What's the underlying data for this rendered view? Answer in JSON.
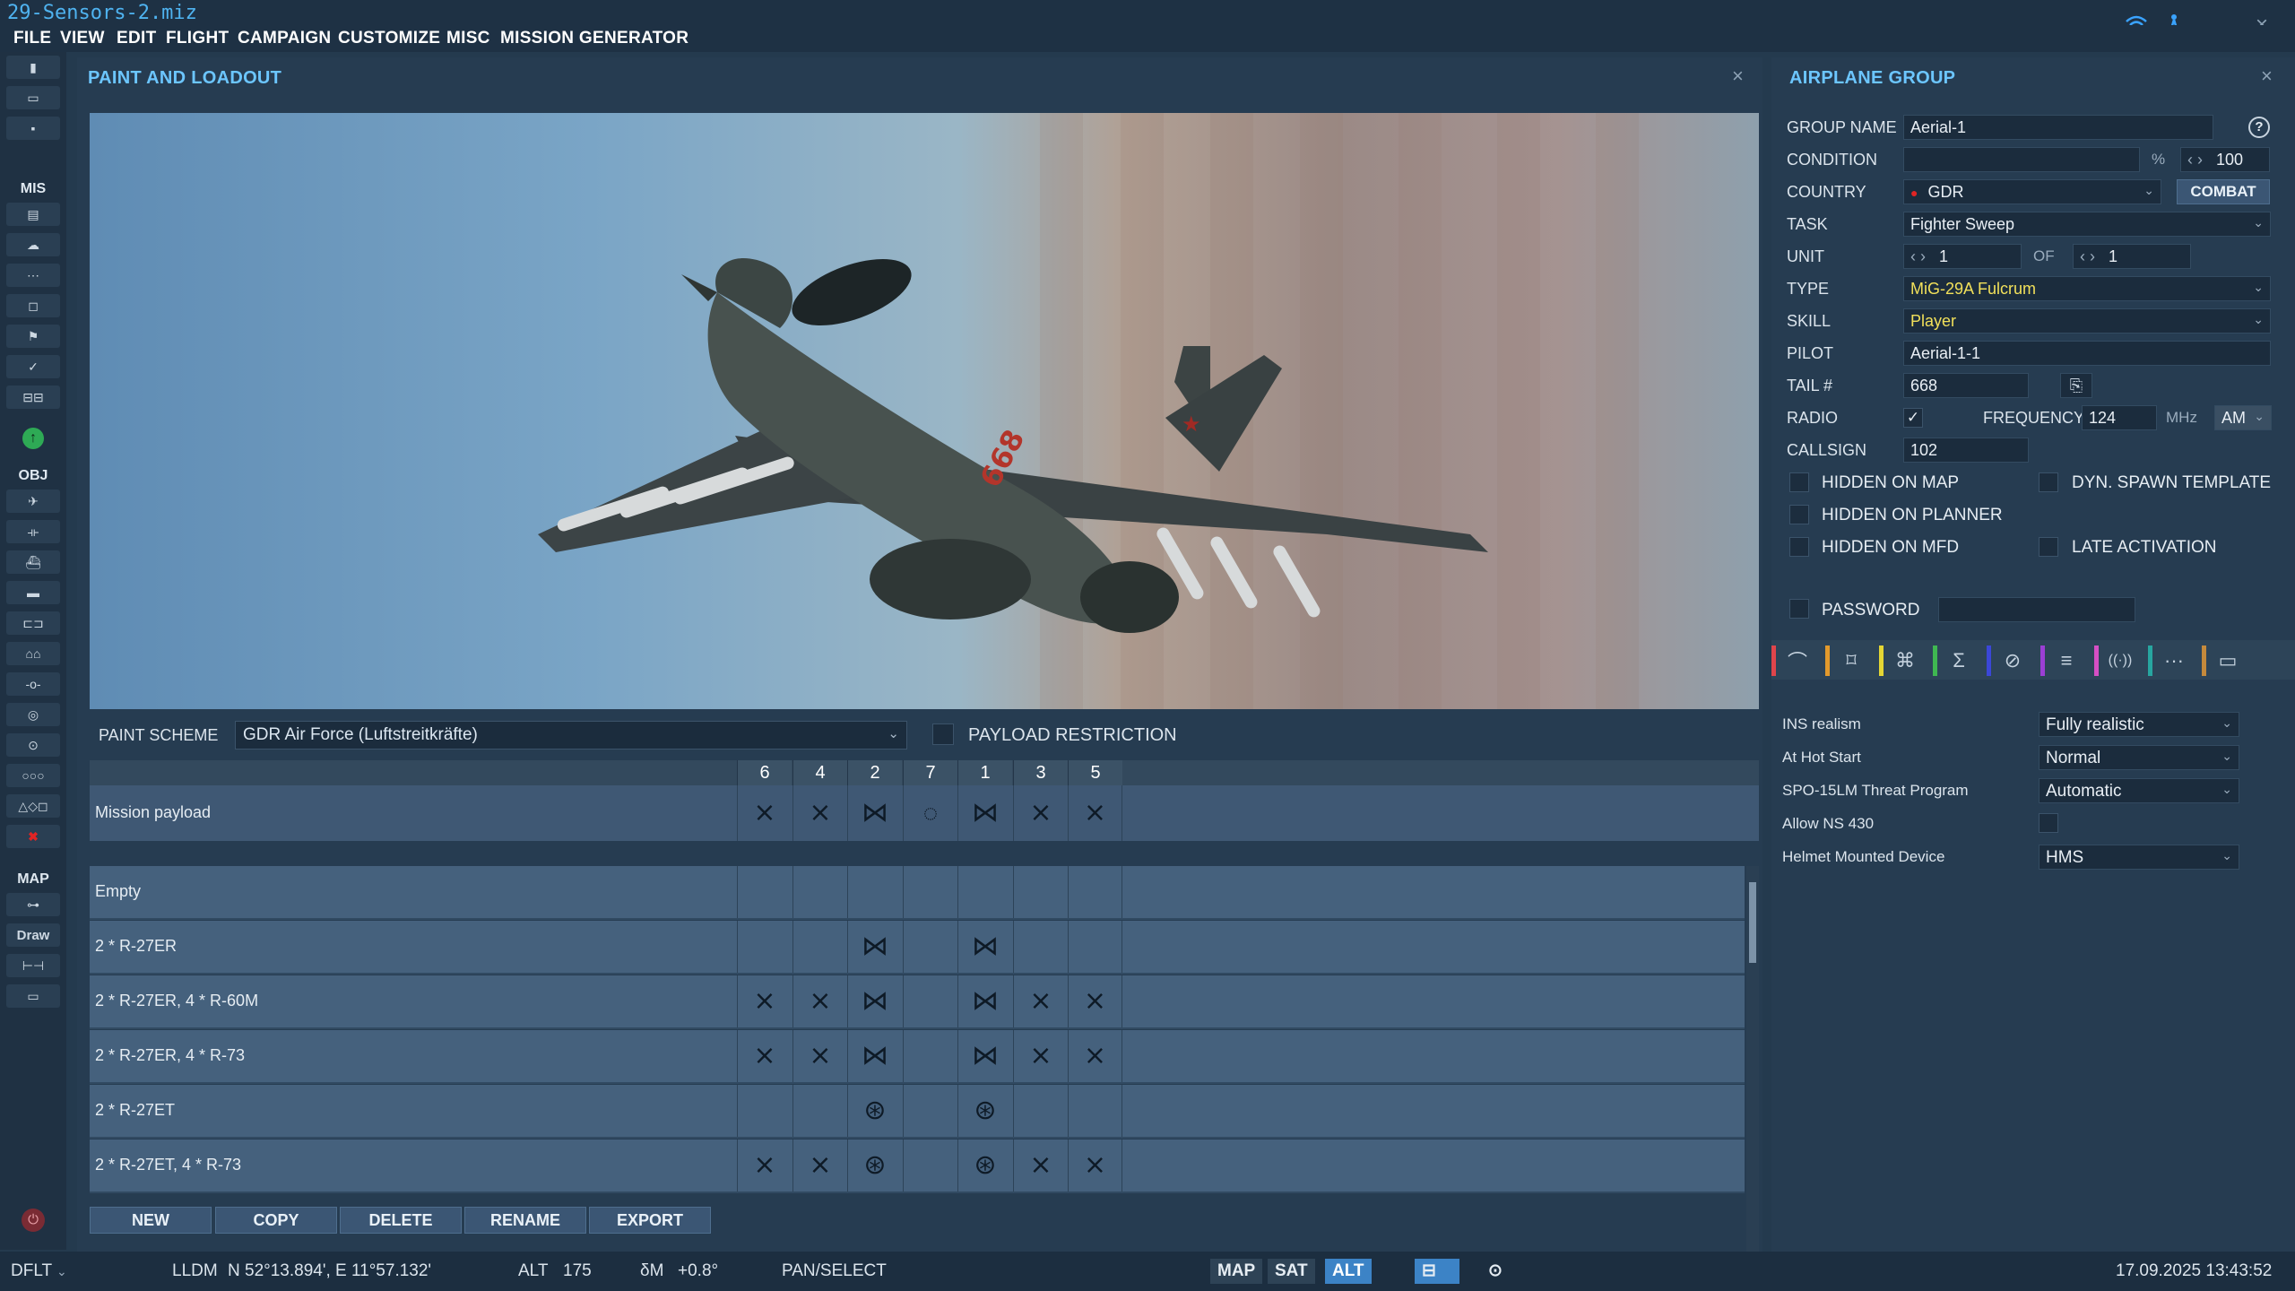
{
  "app": {
    "title": "29-Sensors-2.miz"
  },
  "menu": [
    "FILE",
    "VIEW",
    "EDIT",
    "FLIGHT",
    "CAMPAIGN",
    "CUSTOMIZE",
    "MISC",
    "MISSION GENERATOR"
  ],
  "left_toolbar": {
    "sections": [
      "MIS",
      "OBJ",
      "MAP"
    ],
    "draw_label": "Draw"
  },
  "paint_panel": {
    "title": "PAINT AND LOADOUT",
    "aircraft_tail_number_on_image": "668",
    "paint_scheme_label": "PAINT SCHEME",
    "paint_scheme_value": "GDR Air Force (Luftstreitkräfte)",
    "payload_restriction_label": "PAYLOAD RESTRICTION",
    "pylons": [
      "6",
      "4",
      "2",
      "7",
      "1",
      "3",
      "5"
    ],
    "mission_payload_label": "Mission payload",
    "loadouts": [
      {
        "name": "Empty"
      },
      {
        "name": "2 * R-27ER"
      },
      {
        "name": "2 * R-27ER, 4 * R-60M"
      },
      {
        "name": "2 * R-27ER, 4 * R-73"
      },
      {
        "name": "2 * R-27ET"
      },
      {
        "name": "2 * R-27ET, 4 * R-73"
      }
    ],
    "buttons": [
      "NEW",
      "COPY",
      "DELETE",
      "RENAME",
      "EXPORT"
    ]
  },
  "group_panel": {
    "title": "AIRPLANE GROUP",
    "help_icon_glyph": "?",
    "group_name_label": "GROUP NAME",
    "group_name": "Aerial-1",
    "condition_label": "CONDITION",
    "condition_pct_symbol": "%",
    "condition_value": "100",
    "country_label": "COUNTRY",
    "country": "GDR",
    "combat_button": "COMBAT",
    "task_label": "TASK",
    "task": "Fighter Sweep",
    "unit_label": "UNIT",
    "unit_value": "1",
    "of_label": "OF",
    "unit_total": "1",
    "type_label": "TYPE",
    "type": "MiG-29A Fulcrum",
    "skill_label": "SKILL",
    "skill": "Player",
    "pilot_label": "PILOT",
    "pilot": "Aerial-1-1",
    "tail_label": "TAIL #",
    "tail": "668",
    "radio_label": "RADIO",
    "frequency_label": "FREQUENCY",
    "frequency": "124",
    "mhz_label": "MHz",
    "modulation": "AM",
    "callsign_label": "CALLSIGN",
    "callsign": "102",
    "checks": {
      "hidden_on_map": "HIDDEN ON MAP",
      "dyn_spawn": "DYN. SPAWN TEMPLATE",
      "hidden_on_planner": "HIDDEN ON PLANNER",
      "hidden_on_mfd": "HIDDEN ON MFD",
      "late_activation": "LATE ACTIVATION",
      "password": "PASSWORD"
    },
    "tab_glyphs": [
      "⌒",
      "⌑",
      "⌘",
      "Σ",
      "⊘",
      "≡",
      "((·))",
      "···",
      "▭"
    ],
    "tab_colors": [
      "#e0454b",
      "#e39a2c",
      "#e4d634",
      "#3fb851",
      "#3b47d8",
      "#9b3fd4",
      "#d64fc4",
      "#27a6a0",
      "#c58a3c"
    ],
    "options": [
      {
        "label": "INS realism",
        "value": "Fully realistic"
      },
      {
        "label": "At Hot Start",
        "value": "Normal"
      },
      {
        "label": "SPO-15LM Threat Program",
        "value": "Automatic"
      },
      {
        "label": "Allow NS 430",
        "value": ""
      },
      {
        "label": "Helmet Mounted Device",
        "value": "HMS"
      }
    ]
  },
  "status_bar": {
    "profile": "DFLT",
    "coord_mode": "LLDM",
    "coords": "N 52°13.894', E 11°57.132'",
    "alt_label": "ALT",
    "alt": "175",
    "magvar_label": "δM",
    "magvar": "+0.8°",
    "mode": "PAN/SELECT",
    "map_btn": "MAP",
    "sat_btn": "SAT",
    "alt_btn": "ALT",
    "datetime": "17.09.2025 13:43:52"
  }
}
